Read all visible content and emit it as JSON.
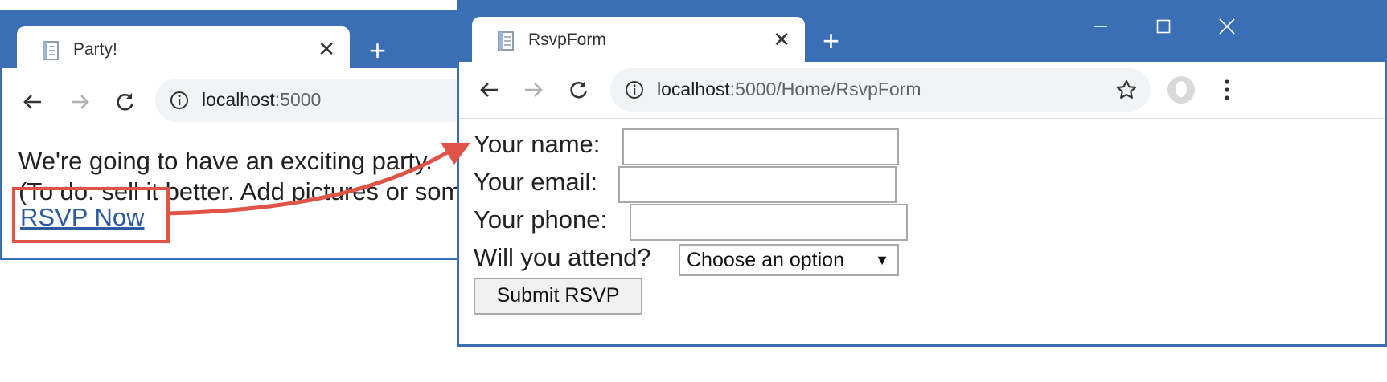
{
  "colors": {
    "chrome_blue": "#3b6fb5",
    "window_border": "#3c6eb4",
    "highlight_red": "#e05448",
    "link_blue": "#2c5aa0"
  },
  "window_party": {
    "tab_title": "Party!",
    "tab_icon": "document-icon",
    "url_host": "localhost",
    "url_rest": ":5000",
    "content_line1": "We're going to have an exciting party.",
    "content_line2": "(To do: sell it better. Add pictures or something.)",
    "rsvp_link": "RSVP Now"
  },
  "window_form": {
    "tab_title": "RsvpForm",
    "tab_icon": "document-icon",
    "url_host": "localhost",
    "url_rest": ":5000/Home/RsvpForm",
    "name_label": "Your name:",
    "email_label": "Your email:",
    "phone_label": "Your phone:",
    "attend_label": "Will you attend?",
    "attend_selected": "Choose an option",
    "submit_label": "Submit RSVP"
  },
  "icons": {
    "back": "arrow-left-icon",
    "forward": "arrow-right-icon",
    "reload": "reload-icon",
    "info": "info-icon",
    "bookmark": "star-icon",
    "profile": "avatar-icon",
    "menu": "kebab-menu-icon",
    "new_tab": "plus-icon",
    "close_tab": "close-icon",
    "minimize": "minimize-icon",
    "maximize": "maximize-icon",
    "close_window": "close-window-icon"
  }
}
